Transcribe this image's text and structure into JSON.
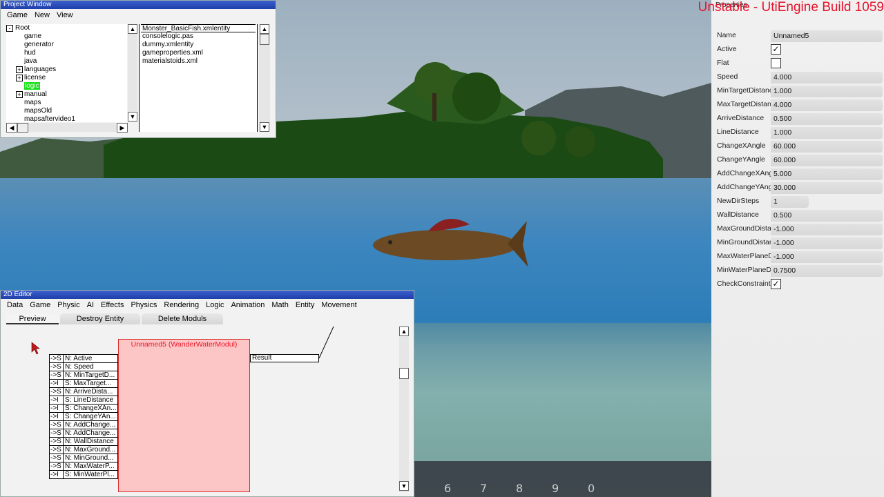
{
  "build_label": "Unstable - UtiEngine Build 1059",
  "hotbar": [
    "6",
    "7",
    "8",
    "9",
    "0"
  ],
  "project_window": {
    "title": "Project Window",
    "menu": [
      "Game",
      "New",
      "View"
    ],
    "tree": [
      {
        "label": "Root",
        "expander": "-",
        "level": 0
      },
      {
        "label": "game",
        "expander": "",
        "level": 1
      },
      {
        "label": "generator",
        "expander": "",
        "level": 1
      },
      {
        "label": "hud",
        "expander": "",
        "level": 1
      },
      {
        "label": "java",
        "expander": "",
        "level": 1
      },
      {
        "label": "languages",
        "expander": "+",
        "level": 1
      },
      {
        "label": "license",
        "expander": "+",
        "level": 1
      },
      {
        "label": "logic",
        "expander": "",
        "level": 1,
        "selected": true
      },
      {
        "label": "manual",
        "expander": "+",
        "level": 1
      },
      {
        "label": "maps",
        "expander": "",
        "level": 1
      },
      {
        "label": "mapsOld",
        "expander": "",
        "level": 1
      },
      {
        "label": "mapsaftervideo1",
        "expander": "",
        "level": 1
      }
    ],
    "files": [
      "Monster_BasicFish.xmlentity",
      "consolelogic.pas",
      "dummy.xmlentity",
      "gameproperties.xml",
      "materialstoids.xml"
    ]
  },
  "properties": {
    "title": "Properties",
    "rows": [
      {
        "label": "Name",
        "type": "text",
        "value": "Unnamed5"
      },
      {
        "label": "Active",
        "type": "check",
        "value": "✓"
      },
      {
        "label": "Flat",
        "type": "check",
        "value": ""
      },
      {
        "label": "Speed",
        "type": "text",
        "value": "4.000"
      },
      {
        "label": "MinTargetDistance",
        "type": "text",
        "value": "1.000"
      },
      {
        "label": "MaxTargetDistance",
        "type": "text",
        "value": "4.000"
      },
      {
        "label": "ArriveDistance",
        "type": "text",
        "value": "0.500"
      },
      {
        "label": "LineDistance",
        "type": "text",
        "value": "1.000"
      },
      {
        "label": "ChangeXAngle",
        "type": "text",
        "value": "60.000"
      },
      {
        "label": "ChangeYAngle",
        "type": "text",
        "value": "60.000"
      },
      {
        "label": "AddChangeXAngle",
        "type": "text",
        "value": "5.000"
      },
      {
        "label": "AddChangeYAngle",
        "type": "text",
        "value": "30.000"
      },
      {
        "label": "NewDirSteps",
        "type": "short",
        "value": "1"
      },
      {
        "label": "WallDistance",
        "type": "text",
        "value": "0.500"
      },
      {
        "label": "MaxGroundDistance",
        "type": "text",
        "value": "-1.000"
      },
      {
        "label": "MinGroundDistance",
        "type": "text",
        "value": "-1.000"
      },
      {
        "label": "MaxWaterPlaneDistance",
        "type": "text",
        "value": "-1.000"
      },
      {
        "label": "MinWaterPlaneDistance",
        "type": "text",
        "value": "0.7500"
      },
      {
        "label": "CheckConstraintsTarget",
        "type": "check",
        "value": "✓"
      }
    ]
  },
  "editor": {
    "title": "2D Editor",
    "menu": [
      "Data",
      "Game",
      "Physic",
      "AI",
      "Effects",
      "Physics",
      "Rendering",
      "Logic",
      "Animation",
      "Math",
      "Entity",
      "Movement"
    ],
    "tabs": [
      "Preview",
      "Destroy Entity",
      "Delete Moduls"
    ],
    "node_title": "Unnamed5 (WanderWaterModul)",
    "ports": [
      {
        "kind": "->S",
        "name": "N: Active"
      },
      {
        "kind": "->S",
        "name": "N: Speed"
      },
      {
        "kind": "->S",
        "name": "N: MinTargetD..."
      },
      {
        "kind": "->I",
        "name": "S: MaxTarget..."
      },
      {
        "kind": "->S",
        "name": "N: ArriveDista..."
      },
      {
        "kind": "->I",
        "name": "S: LineDistance"
      },
      {
        "kind": "->I",
        "name": "S: ChangeXAn..."
      },
      {
        "kind": "->I",
        "name": "S: ChangeYAn..."
      },
      {
        "kind": "->S",
        "name": "N: AddChange..."
      },
      {
        "kind": "->S",
        "name": "N: AddChange..."
      },
      {
        "kind": "->S",
        "name": "N: WallDistance"
      },
      {
        "kind": "->S",
        "name": "N: MaxGround..."
      },
      {
        "kind": "->S",
        "name": "N: MinGround..."
      },
      {
        "kind": "->S",
        "name": "N: MaxWaterP..."
      },
      {
        "kind": "->I",
        "name": "S: MinWaterPl..."
      }
    ],
    "output": "Result"
  }
}
